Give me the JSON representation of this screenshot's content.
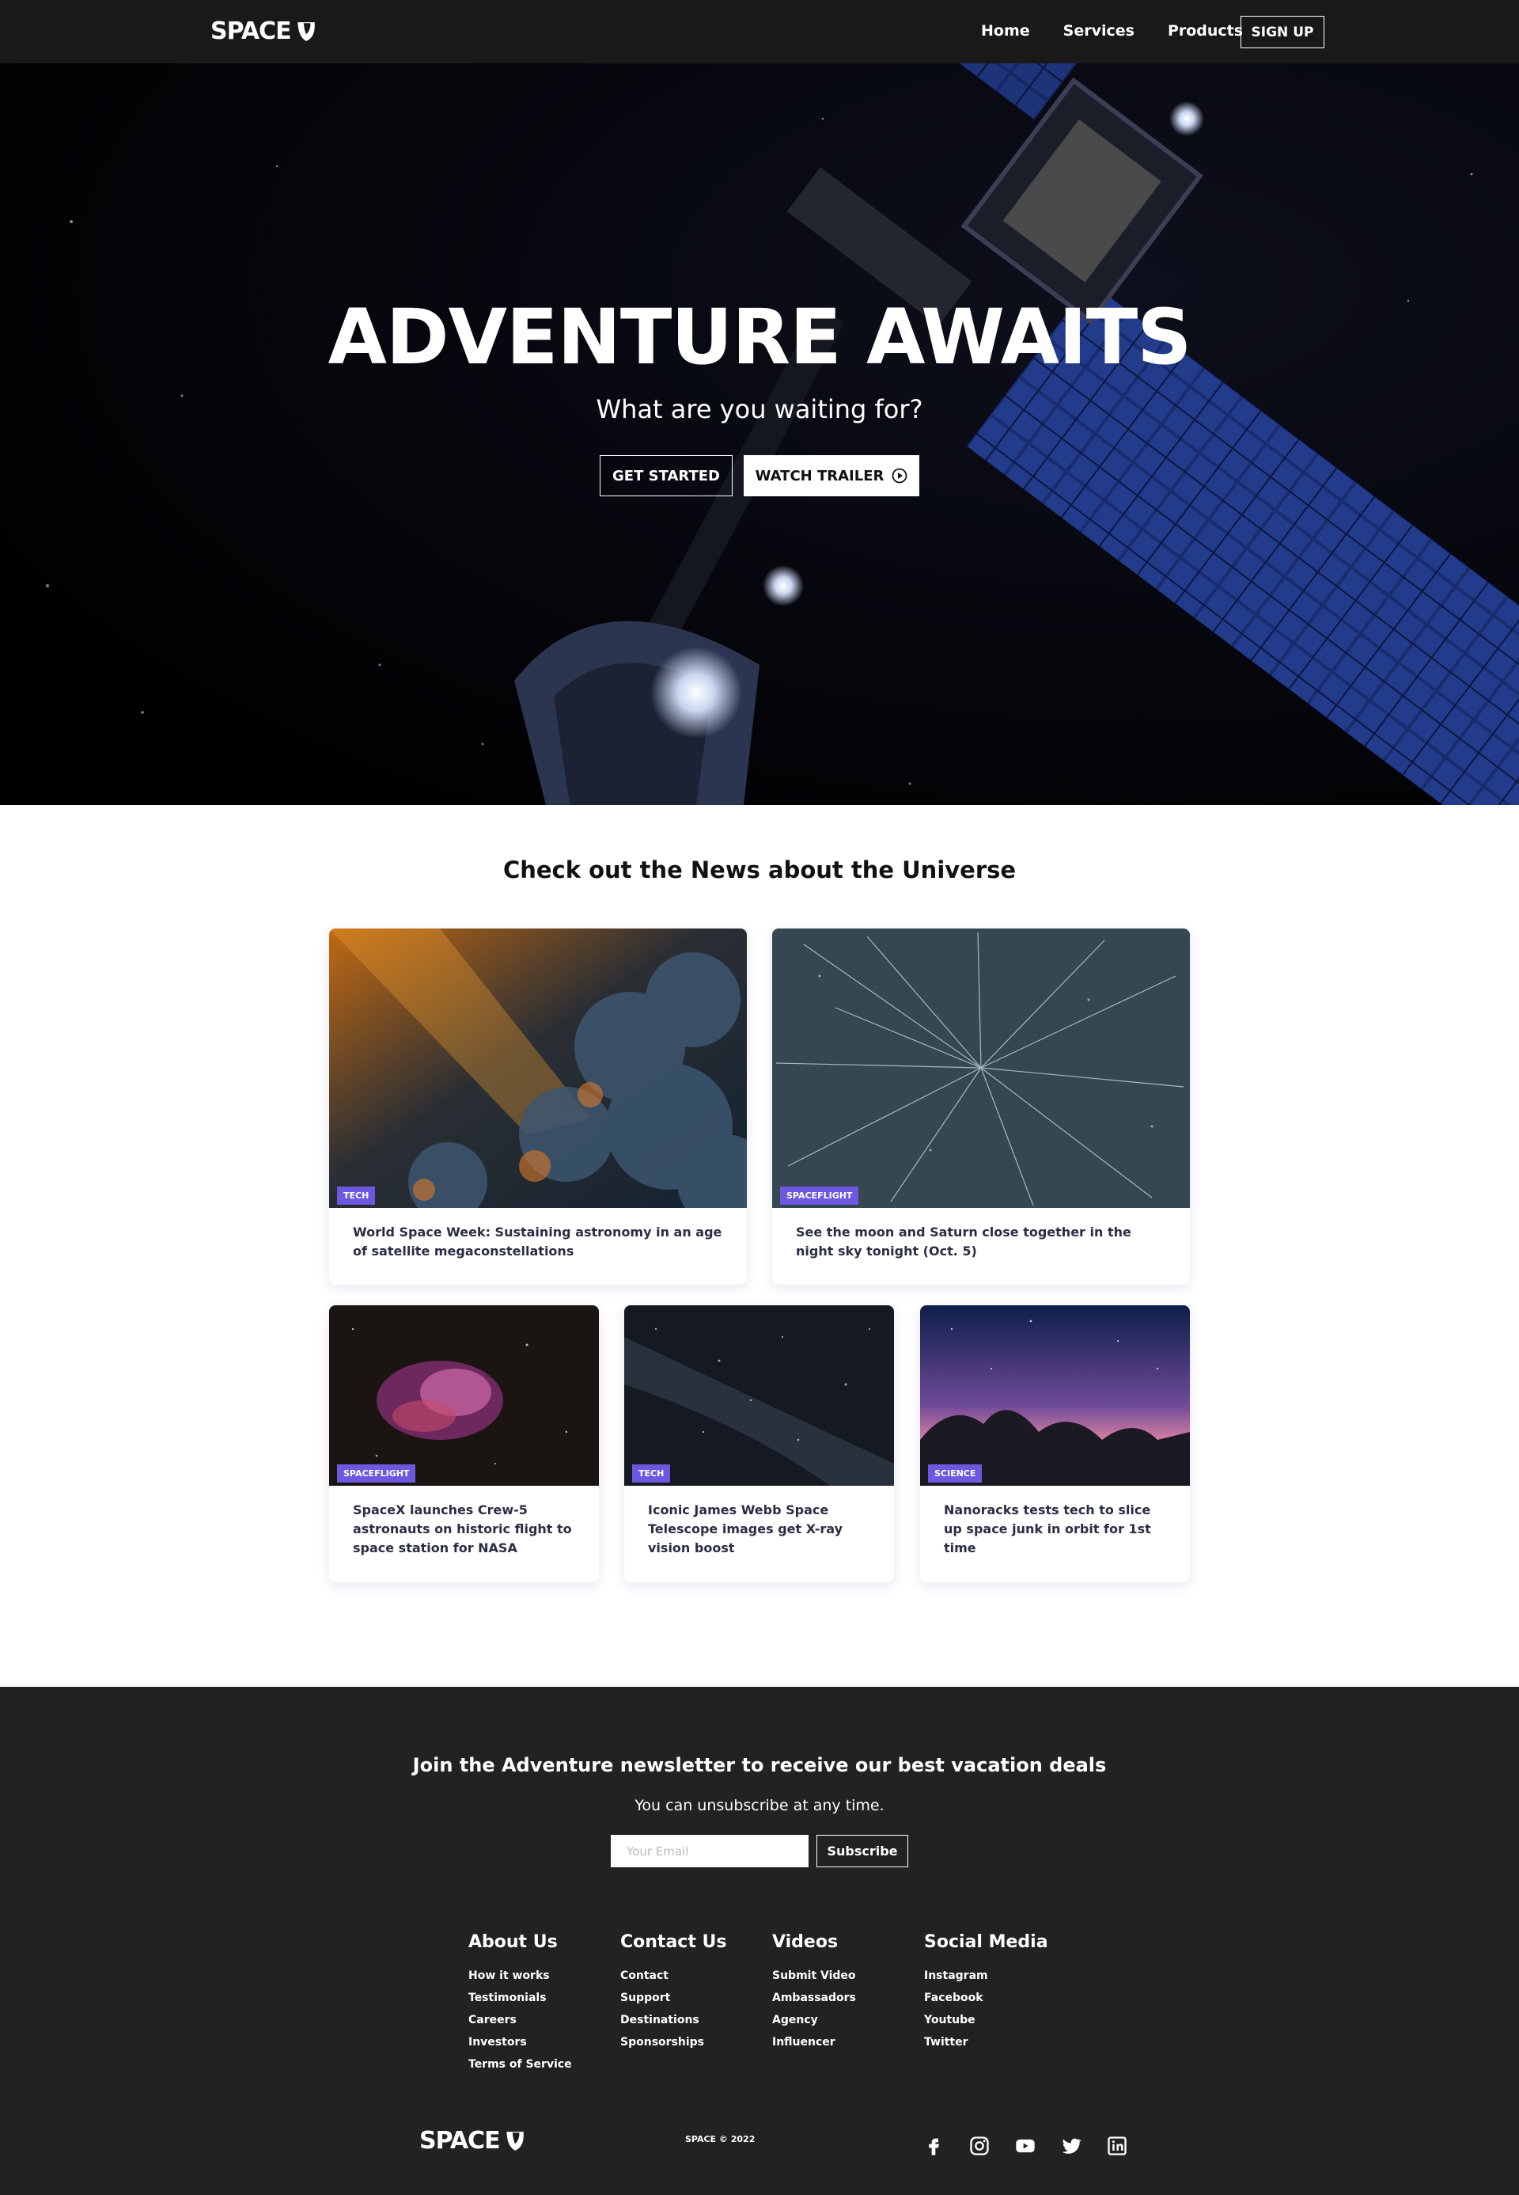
{
  "brand": {
    "name": "SPACE"
  },
  "nav": {
    "links": [
      "Home",
      "Services",
      "Products"
    ],
    "signup": "SIGN UP"
  },
  "hero": {
    "title": "ADVENTURE AWAITS",
    "subtitle": "What are you waiting for?",
    "primary_btn": "GET STARTED",
    "secondary_btn": "WATCH TRAILER"
  },
  "news": {
    "title": "Check out the News about the Universe",
    "cards": [
      {
        "tag": "TECH",
        "text": "World Space Week: Sustaining astronomy in an age of satellite megaconstellations"
      },
      {
        "tag": "SPACEFLIGHT",
        "text": "See the moon and Saturn close together in the night sky tonight (Oct. 5)"
      },
      {
        "tag": "SPACEFLIGHT",
        "text": "SpaceX launches Crew-5 astronauts on historic flight to space station for NASA"
      },
      {
        "tag": "TECH",
        "text": "Iconic James Webb Space Telescope images get X-ray vision boost"
      },
      {
        "tag": "SCIENCE",
        "text": "Nanoracks tests tech to slice up space junk in orbit for 1st time"
      }
    ]
  },
  "newsletter": {
    "title": "Join the Adventure newsletter to receive our best vacation deals",
    "subtitle": "You can unsubscribe at any time.",
    "placeholder": "Your Email",
    "button": "Subscribe"
  },
  "footer": {
    "columns": [
      {
        "title": "About Us",
        "links": [
          "How it works",
          "Testimonials",
          "Careers",
          "Investors",
          "Terms of Service"
        ]
      },
      {
        "title": "Contact Us",
        "links": [
          "Contact",
          "Support",
          "Destinations",
          "Sponsorships"
        ]
      },
      {
        "title": "Videos",
        "links": [
          "Submit Video",
          "Ambassadors",
          "Agency",
          "Influencer"
        ]
      },
      {
        "title": "Social Media",
        "links": [
          "Instagram",
          "Facebook",
          "Youtube",
          "Twitter"
        ]
      }
    ],
    "copyright": "SPACE © 2022",
    "social_icons": [
      "facebook-icon",
      "instagram-icon",
      "youtube-icon",
      "twitter-icon",
      "linkedin-icon"
    ]
  },
  "colors": {
    "tag": "#6e58e0",
    "nav_bg": "#1a1919",
    "footer_bg": "#222222"
  }
}
